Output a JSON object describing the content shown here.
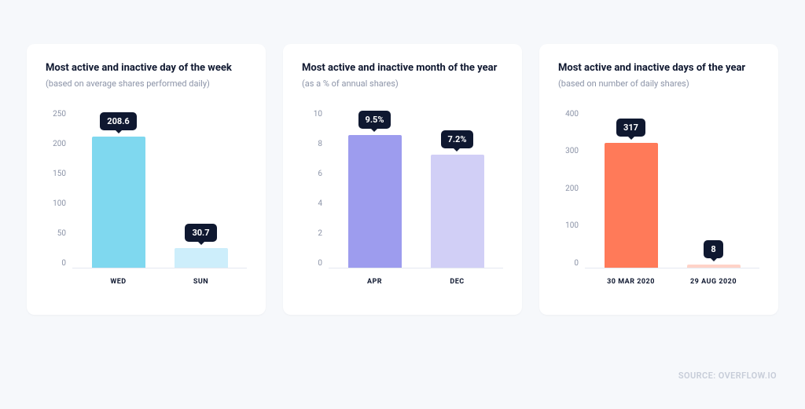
{
  "source_label": "SOURCE: OVERFLOW.IO",
  "chart_data": [
    {
      "type": "bar",
      "title": "Most active and inactive day of the week",
      "subtitle": "(based on average shares performed daily)",
      "categories": [
        "WED",
        "SUN"
      ],
      "values": [
        208.6,
        30.7
      ],
      "value_labels": [
        "208.6",
        "30.7"
      ],
      "bar_colors": [
        "#7fd8ef",
        "#cdeefb"
      ],
      "ylim": [
        0,
        250
      ],
      "yticks": [
        "250",
        "200",
        "150",
        "100",
        "50",
        "0"
      ]
    },
    {
      "type": "bar",
      "title": "Most active and inactive month of the year",
      "subtitle": "(as a % of annual shares)",
      "categories": [
        "APR",
        "DEC"
      ],
      "values": [
        9.5,
        7.2
      ],
      "value_labels": [
        "9.5%",
        "7.2%"
      ],
      "bar_colors": [
        "#9d9cee",
        "#d1cff6"
      ],
      "ylim": [
        0,
        10
      ],
      "yticks": [
        "10",
        "8",
        "6",
        "4",
        "2",
        "0"
      ]
    },
    {
      "type": "bar",
      "title": "Most active and inactive days of the year",
      "subtitle": "(based on number of daily shares)",
      "categories": [
        "30 MAR 2020",
        "29 AUG 2020"
      ],
      "values": [
        317,
        8
      ],
      "value_labels": [
        "317",
        "8"
      ],
      "bar_colors": [
        "#ff7a59",
        "#ffd3c8"
      ],
      "ylim": [
        0,
        400
      ],
      "yticks": [
        "400",
        "300",
        "200",
        "100",
        "0"
      ]
    }
  ]
}
